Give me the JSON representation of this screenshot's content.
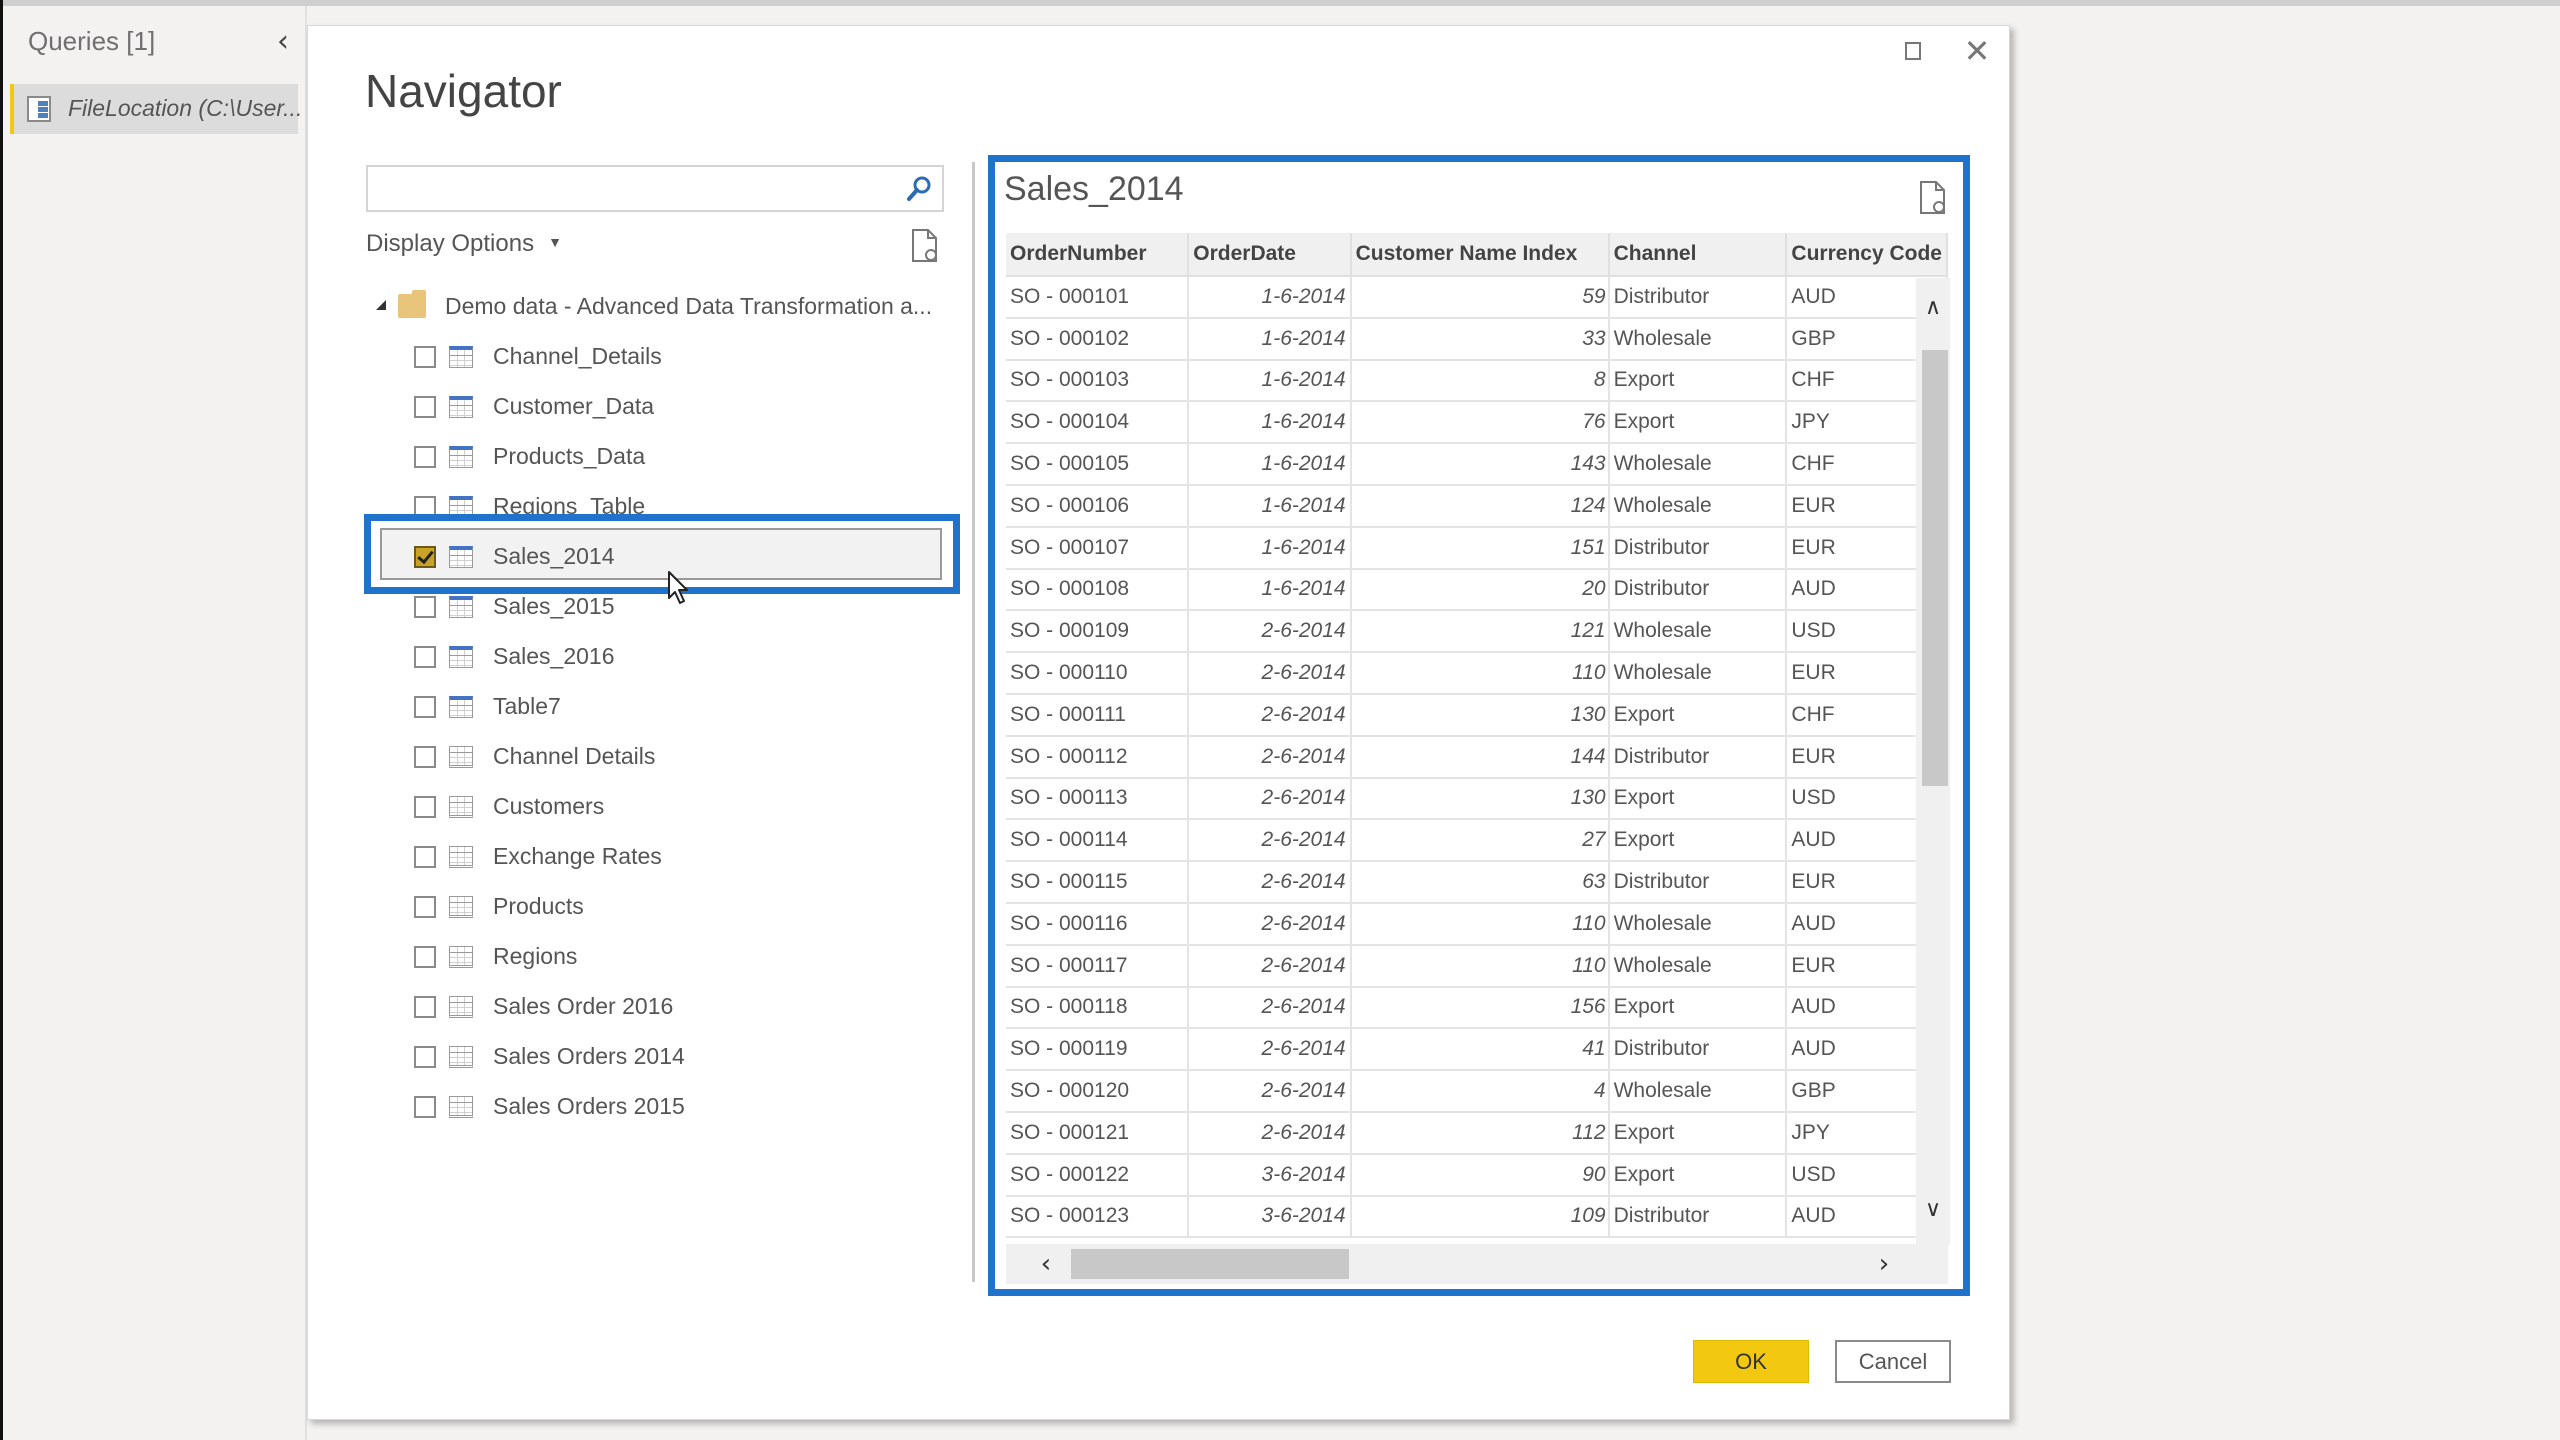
{
  "sidebar": {
    "title": "Queries [1]",
    "collapse_icon": "chevron-left-icon",
    "collapse_glyph": "‹",
    "items": [
      {
        "label": "FileLocation (C:\\User...",
        "icon": "query-table-icon",
        "selected": true
      }
    ]
  },
  "dialog": {
    "title": "Navigator",
    "maximize_icon": "maximize-icon",
    "close_glyph": "✕",
    "search": {
      "value": "",
      "placeholder": ""
    },
    "display_options_label": "Display Options",
    "display_options_caret": "▼",
    "tree": {
      "folder": {
        "label": "Demo data - Advanced Data Transformation a...",
        "expanded": true
      },
      "items": [
        {
          "label": "Channel_Details",
          "type": "table",
          "checked": false
        },
        {
          "label": "Customer_Data",
          "type": "table",
          "checked": false
        },
        {
          "label": "Products_Data",
          "type": "table",
          "checked": false
        },
        {
          "label": "Regions_Table",
          "type": "table",
          "checked": false
        },
        {
          "label": "Sales_2014",
          "type": "table",
          "checked": true,
          "selected": true
        },
        {
          "label": "Sales_2015",
          "type": "table",
          "checked": false
        },
        {
          "label": "Sales_2016",
          "type": "table",
          "checked": false
        },
        {
          "label": "Table7",
          "type": "table",
          "checked": false
        },
        {
          "label": "Channel Details",
          "type": "sheet",
          "checked": false
        },
        {
          "label": "Customers",
          "type": "sheet",
          "checked": false
        },
        {
          "label": "Exchange Rates",
          "type": "sheet",
          "checked": false
        },
        {
          "label": "Products",
          "type": "sheet",
          "checked": false
        },
        {
          "label": "Regions",
          "type": "sheet",
          "checked": false
        },
        {
          "label": "Sales Order 2016",
          "type": "sheet",
          "checked": false
        },
        {
          "label": "Sales Orders 2014",
          "type": "sheet",
          "checked": false
        },
        {
          "label": "Sales Orders 2015",
          "type": "sheet",
          "checked": false
        }
      ]
    },
    "preview": {
      "title": "Sales_2014",
      "columns": [
        "OrderNumber",
        "OrderDate",
        "Customer Name Index",
        "Channel",
        "Currency Code"
      ],
      "rows": [
        [
          "SO - 000101",
          "1-6-2014",
          "59",
          "Distributor",
          "AUD"
        ],
        [
          "SO - 000102",
          "1-6-2014",
          "33",
          "Wholesale",
          "GBP"
        ],
        [
          "SO - 000103",
          "1-6-2014",
          "8",
          "Export",
          "CHF"
        ],
        [
          "SO - 000104",
          "1-6-2014",
          "76",
          "Export",
          "JPY"
        ],
        [
          "SO - 000105",
          "1-6-2014",
          "143",
          "Wholesale",
          "CHF"
        ],
        [
          "SO - 000106",
          "1-6-2014",
          "124",
          "Wholesale",
          "EUR"
        ],
        [
          "SO - 000107",
          "1-6-2014",
          "151",
          "Distributor",
          "EUR"
        ],
        [
          "SO - 000108",
          "1-6-2014",
          "20",
          "Distributor",
          "AUD"
        ],
        [
          "SO - 000109",
          "2-6-2014",
          "121",
          "Wholesale",
          "USD"
        ],
        [
          "SO - 000110",
          "2-6-2014",
          "110",
          "Wholesale",
          "EUR"
        ],
        [
          "SO - 000111",
          "2-6-2014",
          "130",
          "Export",
          "CHF"
        ],
        [
          "SO - 000112",
          "2-6-2014",
          "144",
          "Distributor",
          "EUR"
        ],
        [
          "SO - 000113",
          "2-6-2014",
          "130",
          "Export",
          "USD"
        ],
        [
          "SO - 000114",
          "2-6-2014",
          "27",
          "Export",
          "AUD"
        ],
        [
          "SO - 000115",
          "2-6-2014",
          "63",
          "Distributor",
          "EUR"
        ],
        [
          "SO - 000116",
          "2-6-2014",
          "110",
          "Wholesale",
          "AUD"
        ],
        [
          "SO - 000117",
          "2-6-2014",
          "110",
          "Wholesale",
          "EUR"
        ],
        [
          "SO - 000118",
          "2-6-2014",
          "156",
          "Export",
          "AUD"
        ],
        [
          "SO - 000119",
          "2-6-2014",
          "41",
          "Distributor",
          "AUD"
        ],
        [
          "SO - 000120",
          "2-6-2014",
          "4",
          "Wholesale",
          "GBP"
        ],
        [
          "SO - 000121",
          "2-6-2014",
          "112",
          "Export",
          "JPY"
        ],
        [
          "SO - 000122",
          "3-6-2014",
          "90",
          "Export",
          "USD"
        ],
        [
          "SO - 000123",
          "3-6-2014",
          "109",
          "Distributor",
          "AUD"
        ]
      ]
    },
    "scroll": {
      "up_glyph": "∧",
      "down_glyph": "∨",
      "left_glyph": "‹",
      "right_glyph": "›"
    },
    "buttons": {
      "ok": "OK",
      "cancel": "Cancel"
    }
  },
  "colors": {
    "accent_highlight": "#1f73cc",
    "ok_button": "#f2c811",
    "query_selected_bar": "#f2c811"
  }
}
